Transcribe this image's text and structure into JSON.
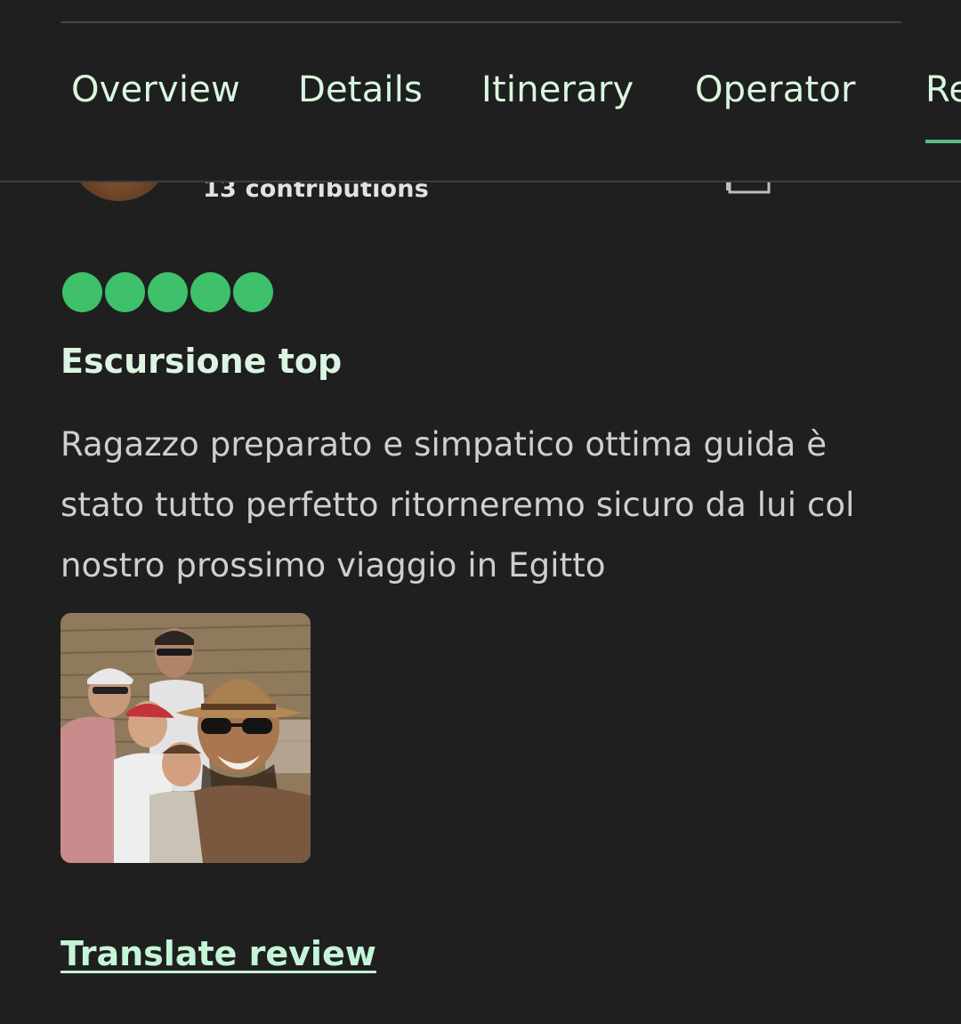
{
  "tabs": [
    {
      "label": "Overview"
    },
    {
      "label": "Details"
    },
    {
      "label": "Itinerary"
    },
    {
      "label": "Operator"
    },
    {
      "label": "Re"
    }
  ],
  "reviewer": {
    "contributions": "13 contributions",
    "avatar_icon": "user-avatar",
    "gallery_icon": "photo-gallery-icon"
  },
  "review": {
    "rating": 5,
    "rating_max": 5,
    "title": "Escursione top",
    "text": "Ragazzo preparato e simpatico ottima guida è stato tutto perfetto ritorneremo sicuro da lui col nostro prossimo viaggio in Egitto",
    "translate_label": "Translate review"
  },
  "colors": {
    "background": "#1f1f1f",
    "accent": "#3ec16a",
    "tab_text": "#d9f7df",
    "active_tab_underline": "#5fbd84",
    "link": "#c4f5d6"
  }
}
